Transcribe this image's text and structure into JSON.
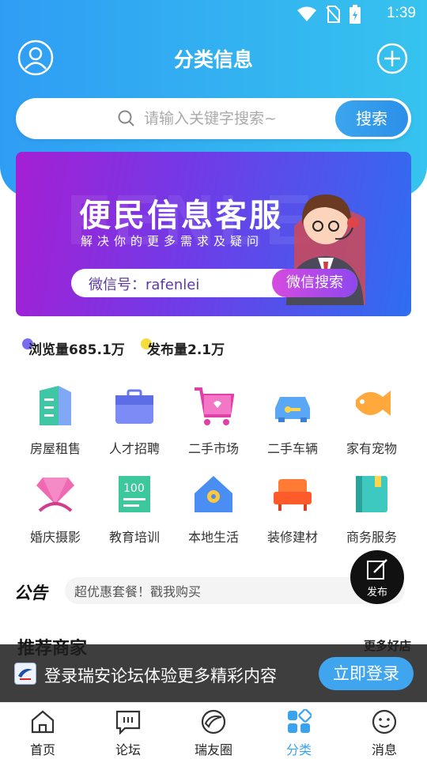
{
  "status_bar": {
    "time": "1:39"
  },
  "header": {
    "title": "分类信息"
  },
  "search": {
    "placeholder": "请输入关键字搜索~",
    "button_label": "搜索"
  },
  "banner": {
    "title": "便民信息客服",
    "subtitle": "解决你的更多需求及疑问",
    "background_text": "FENLEI",
    "wechat_id": "微信号：rafenlei",
    "wechat_search_label": "微信搜索"
  },
  "stats": {
    "views": "浏览量685.1万",
    "posts": "发布量2.1万"
  },
  "categories": [
    {
      "label": "房屋租售",
      "icon": "building-icon"
    },
    {
      "label": "人才招聘",
      "icon": "briefcase-icon"
    },
    {
      "label": "二手市场",
      "icon": "shopping-cart-icon"
    },
    {
      "label": "二手车辆",
      "icon": "car-icon"
    },
    {
      "label": "家有宠物",
      "icon": "pet-fish-icon"
    },
    {
      "label": "婚庆摄影",
      "icon": "diamond-ring-icon"
    },
    {
      "label": "教育培训",
      "icon": "score-paper-icon"
    },
    {
      "label": "本地生活",
      "icon": "home-location-icon"
    },
    {
      "label": "装修建材",
      "icon": "sofa-icon"
    },
    {
      "label": "商务服务",
      "icon": "book-icon"
    }
  ],
  "notice": {
    "logo": "公告",
    "text": "超优惠套餐！戳我购买"
  },
  "publish": {
    "label": "发布"
  },
  "shops": {
    "title": "推荐商家",
    "more": "更多好店"
  },
  "login_prompt": {
    "text": "登录瑞安论坛体验更多精彩内容",
    "button_label": "立即登录"
  },
  "tabbar": [
    {
      "label": "首页",
      "icon": "home-icon",
      "active": false
    },
    {
      "label": "论坛",
      "icon": "forum-icon",
      "active": false
    },
    {
      "label": "瑞友圈",
      "icon": "circle-icon",
      "active": false
    },
    {
      "label": "分类",
      "icon": "category-icon",
      "active": true
    },
    {
      "label": "消息",
      "icon": "message-icon",
      "active": false
    }
  ],
  "colors": {
    "accent": "#3aa3ee",
    "header_gradient_start": "#2f9df4",
    "header_gradient_end": "#36c3ee"
  }
}
